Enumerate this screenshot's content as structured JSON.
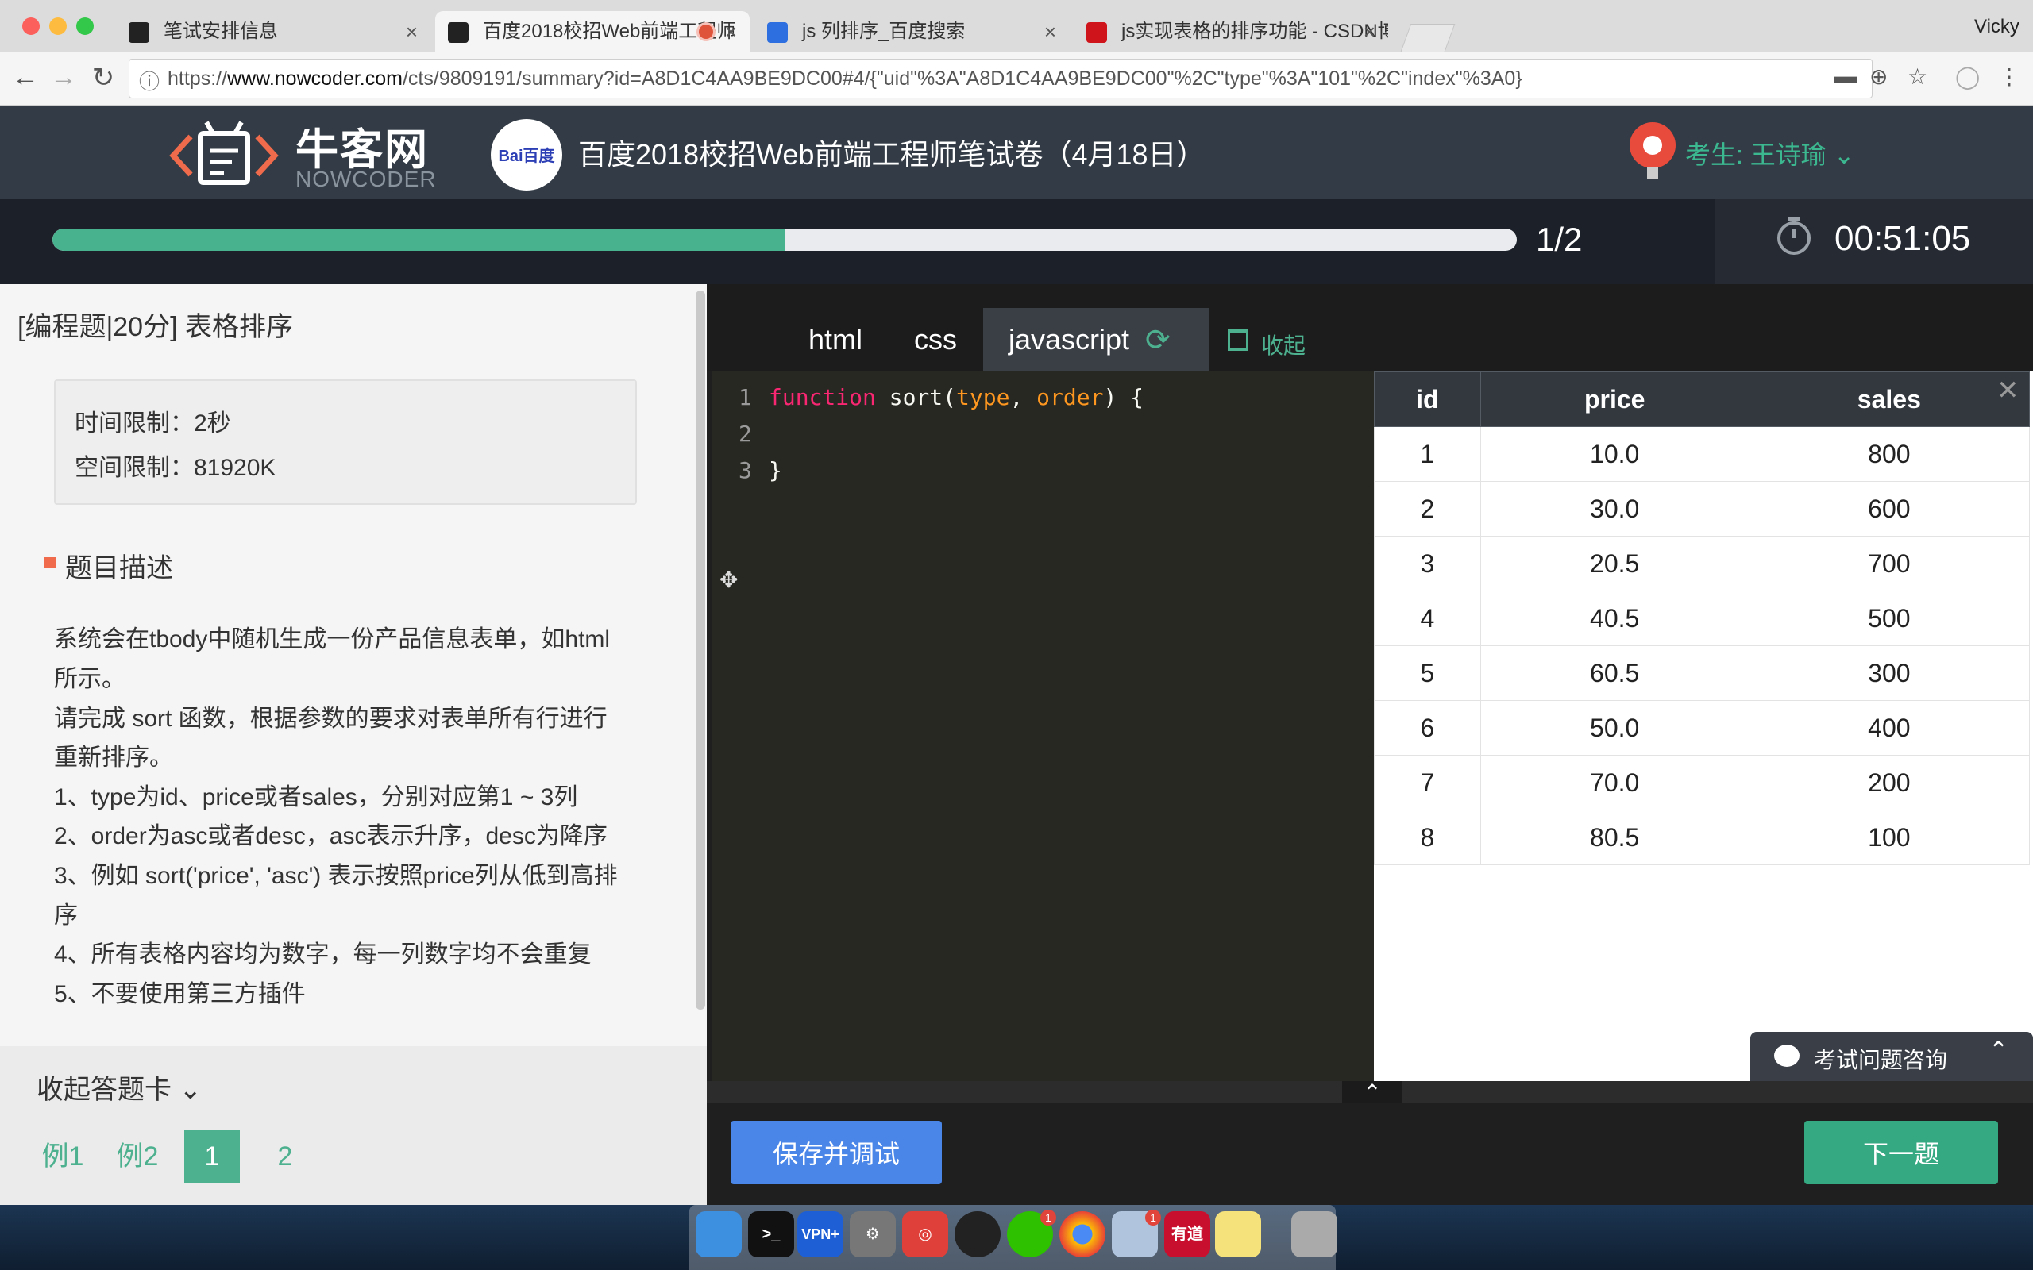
{
  "browser": {
    "user": "Vicky",
    "tabs": [
      {
        "title": "笔试安排信息"
      },
      {
        "title": "百度2018校招Web前端工程师"
      },
      {
        "title": "js 列排序_百度搜索"
      },
      {
        "title": "js实现表格的排序功能 - CSDN博"
      }
    ],
    "url_prefix": "https://",
    "url_host": "www.nowcoder.com",
    "url_path": "/cts/9809191/summary?id=A8D1C4AA9BE9DC00#4/{\"uid\"%3A\"A8D1C4AA9BE9DC00\"%2C\"type\"%3A\"101\"%2C\"index\"%3A0}"
  },
  "header": {
    "logo_cn": "牛客网",
    "logo_en": "NOWCODER",
    "partner_logo": "Bai百度",
    "exam_title": "百度2018校招Web前端工程师笔试卷（4月18日）",
    "candidate": "考生: 王诗瑜"
  },
  "progress": {
    "fraction": 0.5,
    "count": "1/2",
    "timer": "00:51:05"
  },
  "question": {
    "title": "[编程题|20分] 表格排序",
    "time_limit": "时间限制：2秒",
    "space_limit": "空间限制：81920K",
    "section_heading": "题目描述",
    "lines": [
      "系统会在tbody中随机生成一份产品信息表单，如html",
      "所示。",
      "请完成 sort 函数，根据参数的要求对表单所有行进行",
      "重新排序。",
      "1、type为id、price或者sales，分别对应第1 ~ 3列",
      "2、order为asc或者desc，asc表示升序，desc为降序",
      "3、例如 sort('price', 'asc') 表示按照price列从低到高排",
      "序",
      "4、所有表格内容均为数字，每一列数字均不会重复",
      "5、不要使用第三方插件"
    ]
  },
  "answer_card": {
    "toggle_label": "收起答题卡",
    "items": [
      "例1",
      "例2",
      "1",
      "2"
    ]
  },
  "editor": {
    "tabs": [
      "html",
      "css",
      "javascript"
    ],
    "collapse_label": "收起",
    "line_numbers": [
      "1",
      "2",
      "3"
    ],
    "code": {
      "keyword": "function",
      "name": " sort(",
      "param1": "type",
      "comma": ", ",
      "param2": "order",
      "close": ") {",
      "end": "}"
    }
  },
  "preview_table": {
    "headers": [
      "id",
      "price",
      "sales"
    ],
    "rows": [
      [
        "1",
        "10.0",
        "800"
      ],
      [
        "2",
        "30.0",
        "600"
      ],
      [
        "3",
        "20.5",
        "700"
      ],
      [
        "4",
        "40.5",
        "500"
      ],
      [
        "5",
        "60.5",
        "300"
      ],
      [
        "6",
        "50.0",
        "400"
      ],
      [
        "7",
        "70.0",
        "200"
      ],
      [
        "8",
        "80.5",
        "100"
      ]
    ]
  },
  "consult_label": "考试问题咨询",
  "buttons": {
    "save": "保存并调试",
    "next": "下一题"
  },
  "dock": {
    "vpn_label": "VPN+",
    "youdao_label": "有道",
    "wechat_badge": "1",
    "mail_badge": "1"
  },
  "colors": {
    "accent": "#4db08f",
    "save_button": "#4a86e8",
    "header_bg": "#333c46"
  }
}
